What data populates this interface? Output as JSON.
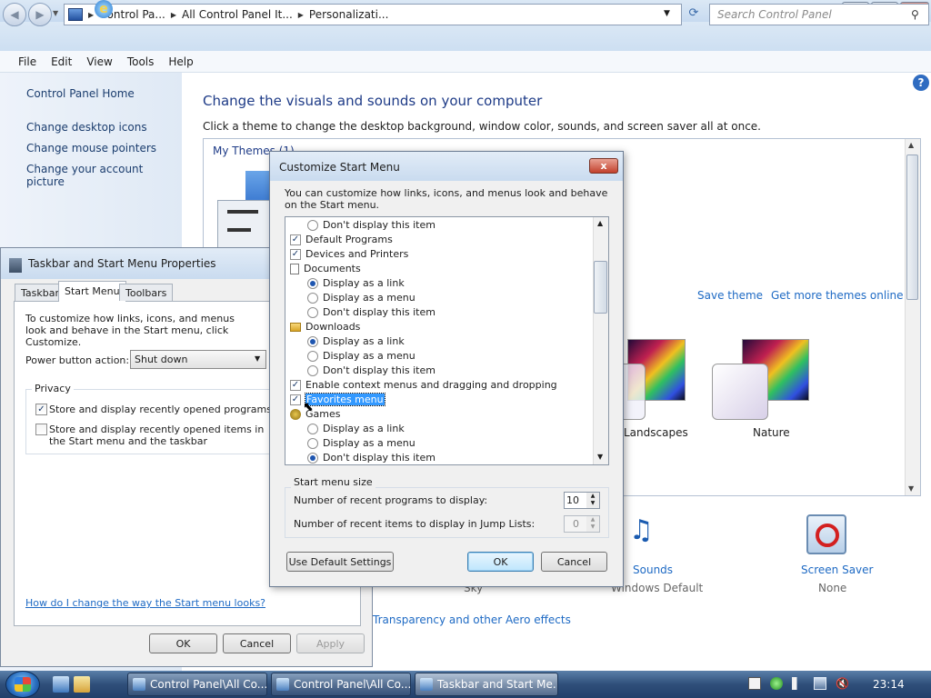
{
  "explorer": {
    "breadcrumbs": [
      "Control Pa...",
      "All Control Panel It...",
      "Personalizati..."
    ],
    "search_placeholder": "Search Control Panel",
    "menu": [
      "File",
      "Edit",
      "View",
      "Tools",
      "Help"
    ],
    "left_pane": {
      "home": "Control Panel Home",
      "links": [
        "Change desktop icons",
        "Change mouse pointers",
        "Change your account picture"
      ]
    },
    "title": "Change the visuals and sounds on your computer",
    "subtitle": "Click a theme to change the desktop background, window color, sounds, and screen saver all at once.",
    "my_themes": "My Themes (1)",
    "save_theme": "Save theme",
    "get_more_themes": "Get more themes online",
    "themes": [
      "Landscapes",
      "Nature"
    ],
    "sounds": {
      "label": "Sounds",
      "value": "Windows Default"
    },
    "screen_saver": {
      "label": "Screen Saver",
      "value": "None"
    },
    "sky_label": "Sky",
    "aero_link": "Transparency and other Aero effects"
  },
  "taskbar_props": {
    "title": "Taskbar and Start Menu Properties",
    "tabs": [
      "Taskbar",
      "Start Menu",
      "Toolbars"
    ],
    "intro": "To customize how links, icons, and menus look and behave in the Start menu, click Customize.",
    "power_label": "Power button action:",
    "power_value": "Shut down",
    "privacy_label": "Privacy",
    "privacy_items": [
      {
        "label": "Store and display recently opened programs in the Start menu",
        "checked": true
      },
      {
        "label": "Store and display recently opened items in the Start menu and the taskbar",
        "checked": false
      }
    ],
    "how_link": "How do I change the way the Start menu looks?",
    "buttons": {
      "ok": "OK",
      "cancel": "Cancel",
      "apply": "Apply"
    }
  },
  "customize": {
    "title": "Customize Start Menu",
    "close": "x",
    "intro": "You can customize how links, icons, and menus look and behave on the Start menu.",
    "items": [
      {
        "type": "radio",
        "label": "Don't display this item",
        "checked": false
      },
      {
        "type": "check",
        "label": "Default Programs",
        "checked": true
      },
      {
        "type": "check",
        "label": "Devices and Printers",
        "checked": true
      },
      {
        "type": "header",
        "label": "Documents",
        "icon": "document-icon"
      },
      {
        "type": "radio",
        "label": "Display as a link",
        "checked": true
      },
      {
        "type": "radio",
        "label": "Display as a menu",
        "checked": false
      },
      {
        "type": "radio",
        "label": "Don't display this item",
        "checked": false
      },
      {
        "type": "header",
        "label": "Downloads",
        "icon": "folder-icon"
      },
      {
        "type": "radio",
        "label": "Display as a link",
        "checked": true
      },
      {
        "type": "radio",
        "label": "Display as a menu",
        "checked": false
      },
      {
        "type": "radio",
        "label": "Don't display this item",
        "checked": false
      },
      {
        "type": "check",
        "label": "Enable context menus and dragging and dropping",
        "checked": true
      },
      {
        "type": "check",
        "label": "Favorites menu",
        "checked": true,
        "selected": true
      },
      {
        "type": "header",
        "label": "Games",
        "icon": "games-icon"
      },
      {
        "type": "radio",
        "label": "Display as a link",
        "checked": false
      },
      {
        "type": "radio",
        "label": "Display as a menu",
        "checked": false
      },
      {
        "type": "radio",
        "label": "Don't display this item",
        "checked": true
      }
    ],
    "size_group": "Start menu size",
    "recent_programs_label": "Number of recent programs to display:",
    "recent_programs_value": "10",
    "recent_jump_label": "Number of recent items to display in Jump Lists:",
    "recent_jump_value": "0",
    "buttons": {
      "default": "Use Default Settings",
      "ok": "OK",
      "cancel": "Cancel"
    }
  },
  "taskbar": {
    "buttons": [
      "Control Panel\\All Co...",
      "Control Panel\\All Co...",
      "Taskbar and Start Me..."
    ],
    "clock": "23:14"
  }
}
